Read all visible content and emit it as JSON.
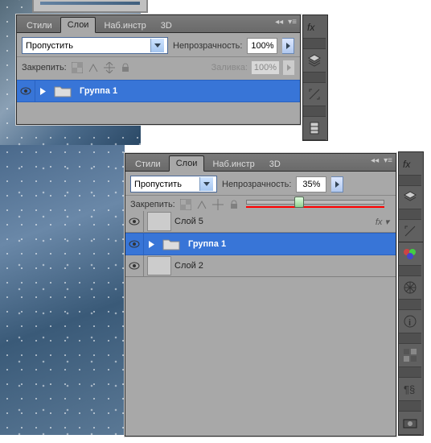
{
  "panel1": {
    "tabs": [
      "Стили",
      "Слои",
      "Наб.инстр",
      "3D"
    ],
    "active_tab": 1,
    "blend_mode": "Пропустить",
    "opacity_label": "Непрозрачность:",
    "opacity_value": "100%",
    "lock_label": "Закрепить:",
    "fill_label": "Заливка:",
    "fill_value": "100%",
    "layers": [
      {
        "name": "Группа 1",
        "type": "group",
        "selected": true
      }
    ]
  },
  "panel2": {
    "tabs": [
      "Стили",
      "Слои",
      "Наб.инстр",
      "3D"
    ],
    "active_tab": 1,
    "blend_mode": "Пропустить",
    "opacity_label": "Непрозрачность:",
    "opacity_value": "35%",
    "slider_pct": 35,
    "lock_label": "Закрепить:",
    "layers": [
      {
        "name": "Слой 5",
        "type": "layer",
        "selected": false,
        "fx": true,
        "thumb": "checker"
      },
      {
        "name": "Группа 1",
        "type": "group",
        "selected": true
      },
      {
        "name": "Слой 2",
        "type": "layer",
        "selected": false,
        "thumb": "image"
      }
    ]
  },
  "icons": {
    "eye": "eye-icon",
    "folder": "folder-icon",
    "fx": "fx",
    "triangle": "▸",
    "chevron": "▾",
    "collapse": "◂◂",
    "menu": "≡"
  }
}
